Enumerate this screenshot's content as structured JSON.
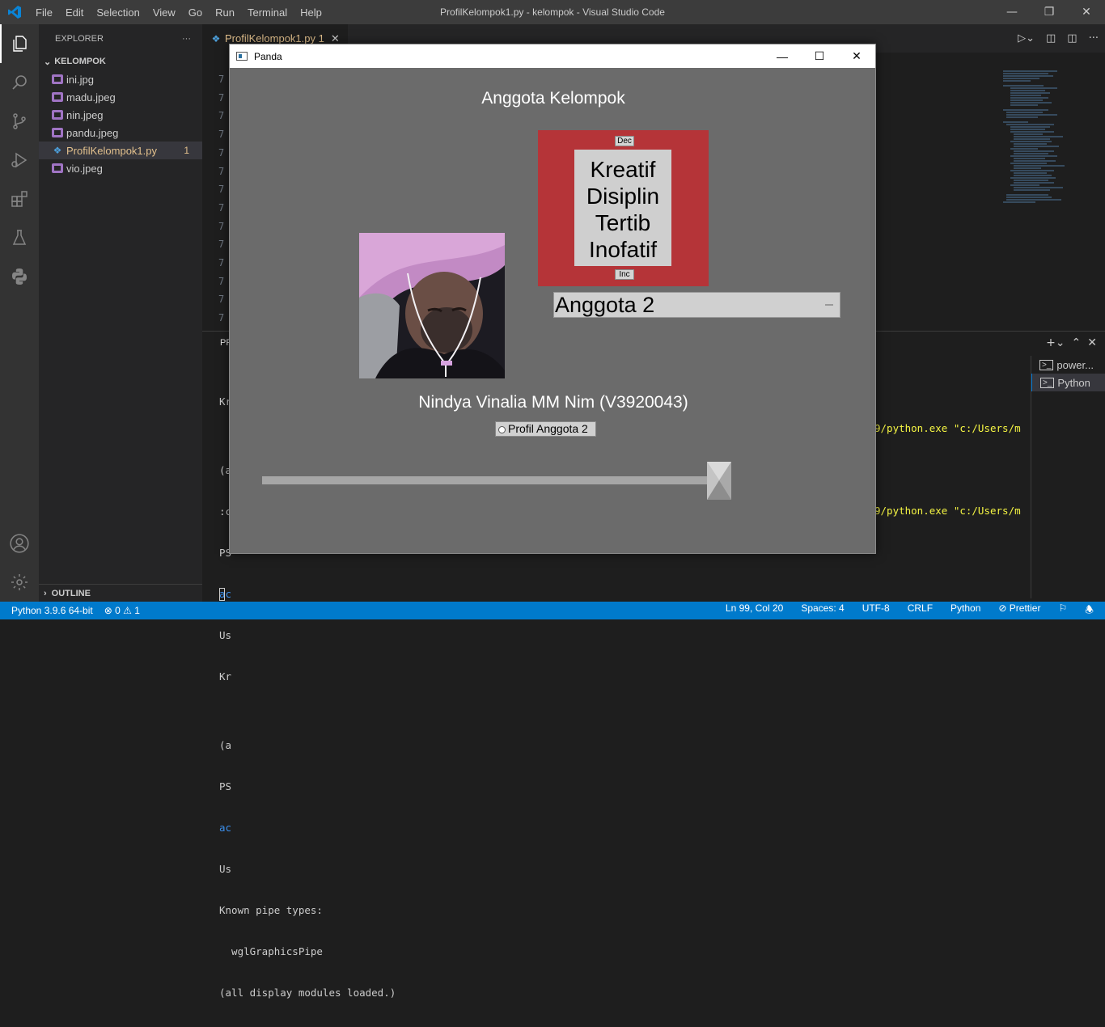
{
  "titlebar": {
    "menus": [
      "File",
      "Edit",
      "Selection",
      "View",
      "Go",
      "Run",
      "Terminal",
      "Help"
    ],
    "window_title": "ProfilKelompok1.py - kelompok - Visual Studio Code"
  },
  "activity_icons": [
    "explorer-icon",
    "search-icon",
    "source-control-icon",
    "run-debug-icon",
    "extensions-icon",
    "testing-icon",
    "python-icon",
    "account-icon",
    "settings-gear-icon"
  ],
  "sidebar": {
    "header": "EXPLORER",
    "folder": "KELOMPOK",
    "files": [
      {
        "name": "ini.jpg",
        "type": "image"
      },
      {
        "name": "madu.jpeg",
        "type": "image"
      },
      {
        "name": "nin.jpeg",
        "type": "image"
      },
      {
        "name": "pandu.jpeg",
        "type": "image"
      },
      {
        "name": "ProfilKelompok1.py",
        "type": "python",
        "badge": "1",
        "selected": true
      },
      {
        "name": "vio.jpeg",
        "type": "image"
      }
    ],
    "outline": "OUTLINE"
  },
  "editor": {
    "tab_label": "ProfilKelompok1.py 1",
    "gutter_digit": "7"
  },
  "panel": {
    "tab_fragment": "PF",
    "terminal": {
      "lines": [
        "Kr",
        "",
        "(a",
        ":c",
        "PS",
        "ac",
        "Us",
        "Kr",
        "",
        "(a",
        "PS",
        "ac",
        "Us",
        "Known pipe types:",
        "  wglGraphicsPipe",
        "(all display modules loaded.)"
      ],
      "cmd_fragment_1": "9/python.exe \"c:/Users/m",
      "cmd_fragment_2": "9/python.exe \"c:/Users/m"
    },
    "terminals": [
      "power...",
      "Python"
    ]
  },
  "statusbar": {
    "interpreter": "Python 3.9.6 64-bit",
    "errors": "0",
    "warnings": "1",
    "position": "Ln 99, Col 20",
    "spaces": "Spaces: 4",
    "encoding": "UTF-8",
    "eol": "CRLF",
    "language": "Python",
    "formatter": "Prettier"
  },
  "panda_window": {
    "title": "Panda",
    "heading": "Anggota Kelompok",
    "dec_button": "Dec",
    "inc_button": "Inc",
    "motto": [
      "Kreatif",
      "Disiplin",
      "Tertib",
      "Inofatif"
    ],
    "entry_value": "Anggota 2",
    "caption": "Nindya Vinalia MM Nim (V3920043)",
    "radio_label": "Profil Anggota 2",
    "slider_level": 1.0
  },
  "colors": {
    "accent": "#007acc",
    "panda_bg": "#6b6b6b",
    "frame_red": "#b53438"
  }
}
